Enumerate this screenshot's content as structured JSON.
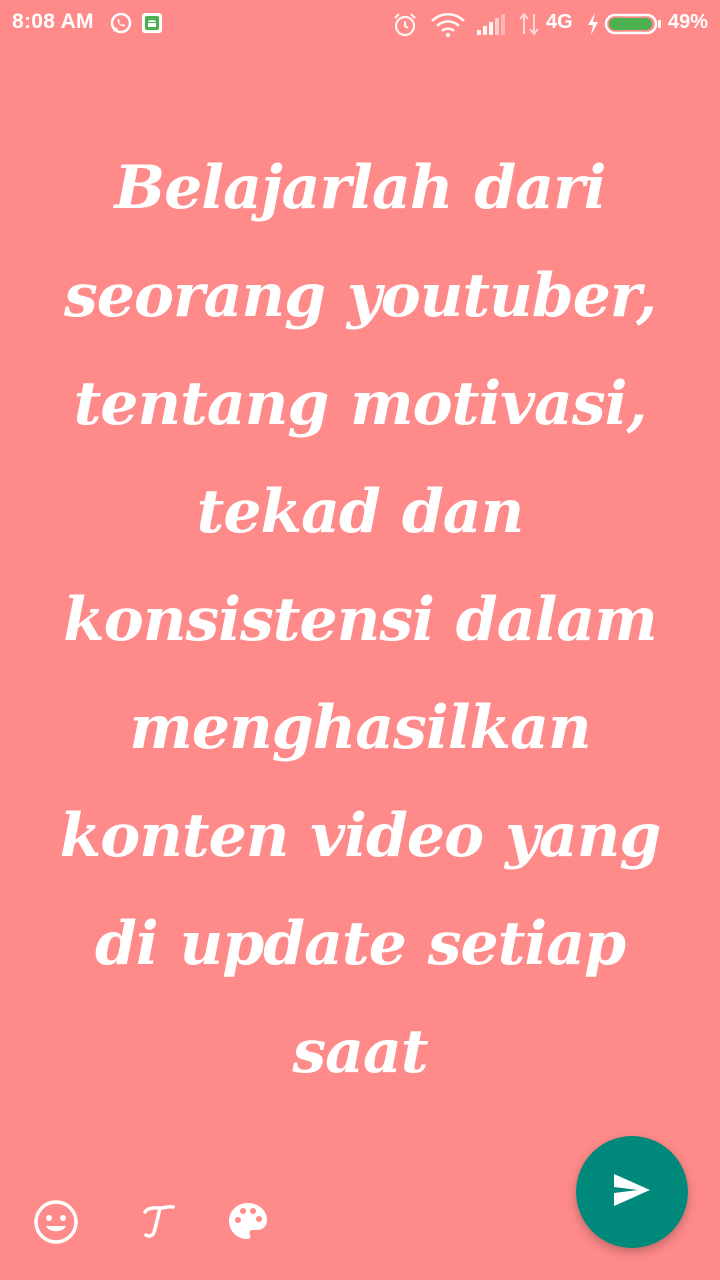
{
  "status_bar": {
    "time": "8:08 AM",
    "network_type": "4G",
    "battery_percent": "49%",
    "battery_level": 0.49,
    "icons": [
      "whatsapp-icon",
      "android-notification-icon",
      "alarm-icon",
      "wifi-icon",
      "signal-icon",
      "data-arrows-icon",
      "charging-icon",
      "battery-icon"
    ]
  },
  "caption": {
    "text": "Belajarlah dari seorang youtuber, tentang motivasi, tekad dan konsistensi dalam menghasilkan konten video yang di update setiap saat"
  },
  "toolbar": {
    "icons": [
      "emoji-icon",
      "text-font-icon",
      "palette-icon",
      "send-icon"
    ]
  },
  "colors": {
    "background": "#ff8a8a",
    "text": "#ffffff",
    "send_button": "#00897b"
  }
}
